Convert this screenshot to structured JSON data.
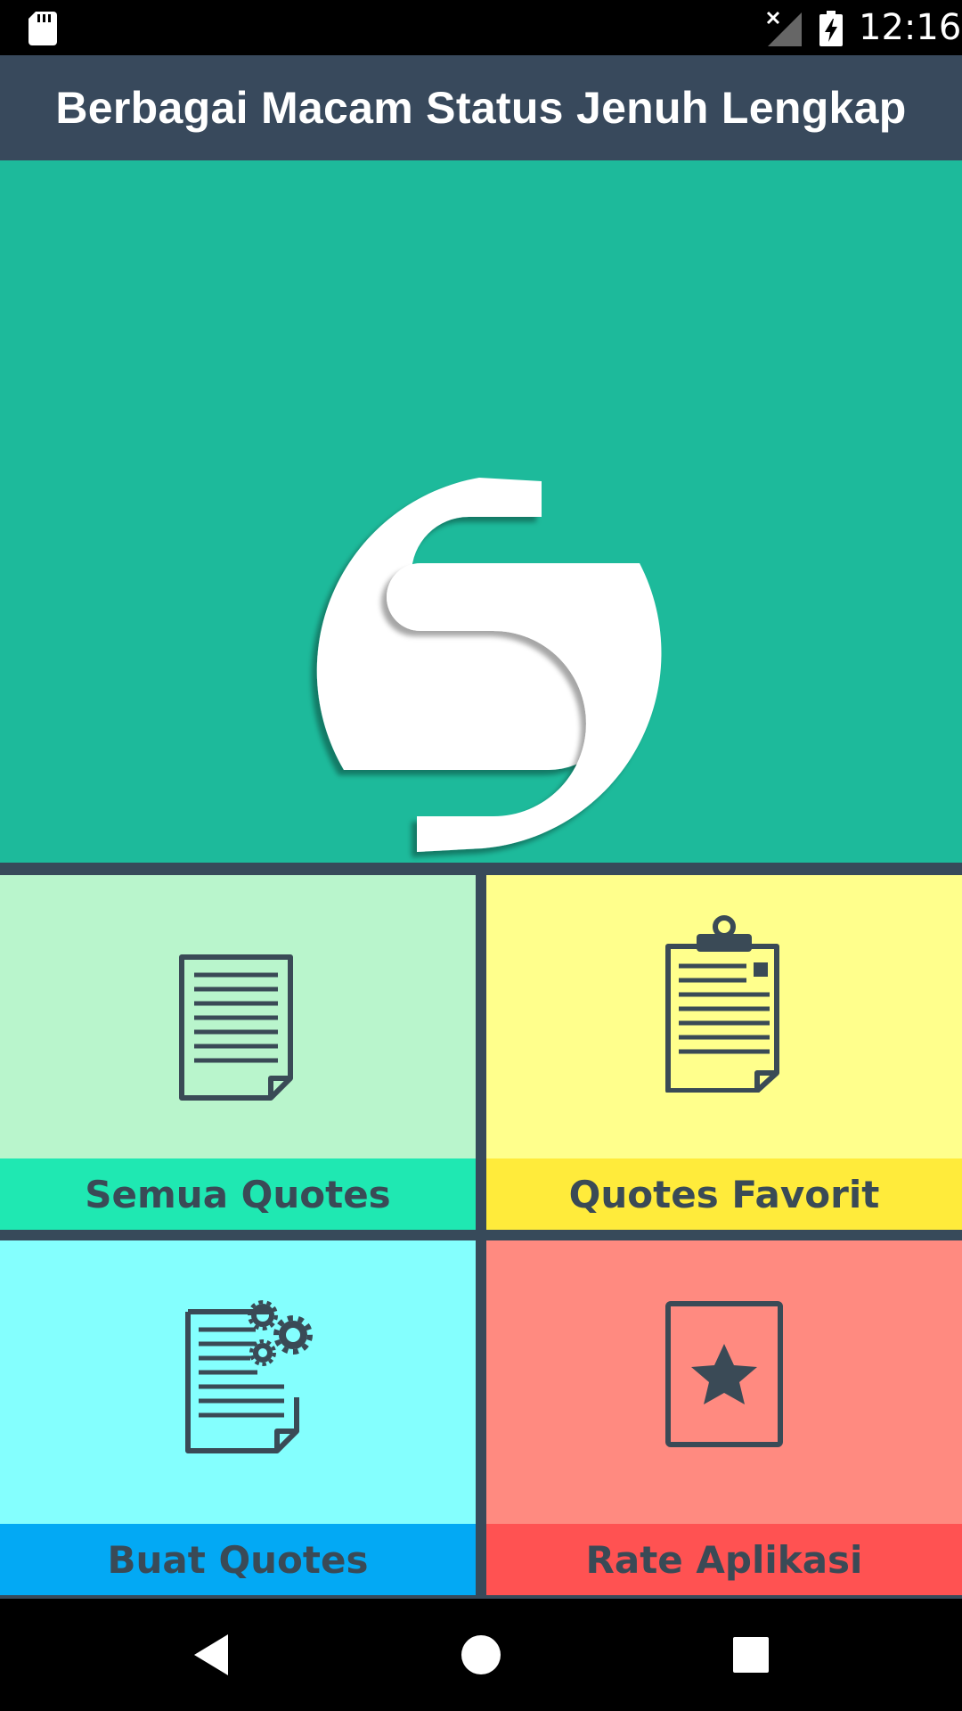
{
  "status_bar": {
    "time": "12:16",
    "icons": [
      "sd-card-icon",
      "no-signal-icon",
      "battery-charging-icon"
    ]
  },
  "app_bar": {
    "title": "Berbagai Macam Status Jenuh Lengkap"
  },
  "hero": {
    "logo_icon": "s-logo-icon",
    "background": "#1dba9b"
  },
  "menu": {
    "tiles": [
      {
        "label": "Semua Quotes",
        "icon": "document-icon",
        "bg": "#b9f5cc",
        "label_bg": "#1fe8b2"
      },
      {
        "label": "Quotes Favorit",
        "icon": "clipboard-icon",
        "bg": "#ffff8c",
        "label_bg": "#ffeb3b"
      },
      {
        "label": "Buat Quotes",
        "icon": "document-settings-icon",
        "bg": "#84fffe",
        "label_bg": "#03a9f4"
      },
      {
        "label": "Rate Aplikasi",
        "icon": "star-card-icon",
        "bg": "#ff8a80",
        "label_bg": "#ff5252"
      }
    ]
  },
  "nav_bar": {
    "icons": [
      "back-icon",
      "home-icon",
      "recents-icon"
    ]
  },
  "colors": {
    "app_bar": "#38495c",
    "divider": "#374a5a",
    "icon_stroke": "#3a4a56"
  }
}
